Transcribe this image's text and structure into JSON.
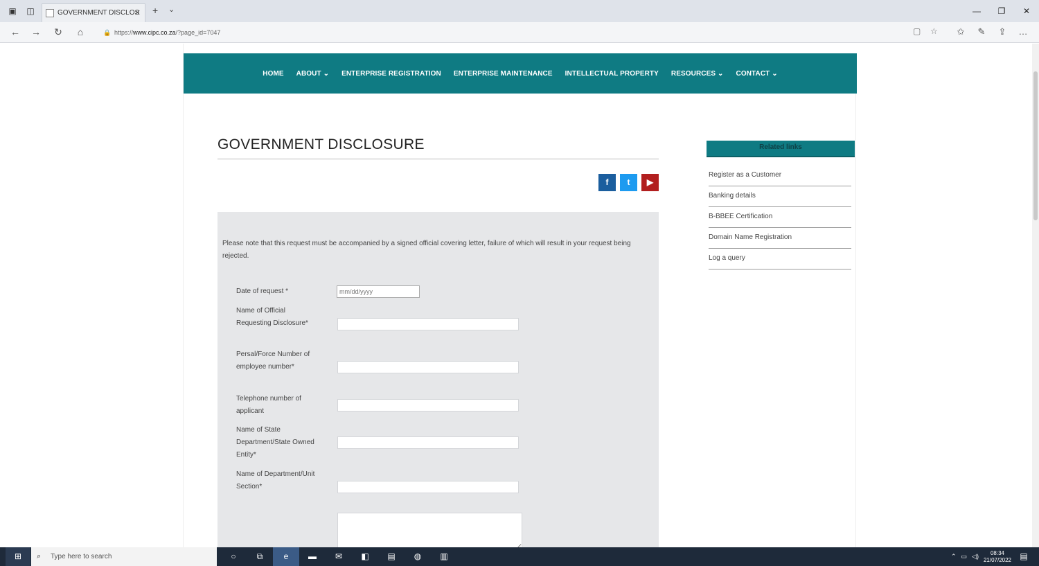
{
  "browser": {
    "tab_title": "GOVERNMENT DISCLOS",
    "url_prefix": "https://",
    "url_host": "www.cipc.co.za",
    "url_path": "/?page_id=7047",
    "icons": {
      "tab_set_aside": "tab-icon",
      "tab_preview": "tabs-icon",
      "new_tab": "+",
      "tab_dropdown": "⌄",
      "back": "←",
      "forward": "→",
      "refresh": "↻",
      "home": "⌂",
      "reading_view": "▢",
      "favorite": "☆",
      "favorites_bar": "✩",
      "notes": "✎",
      "share": "⇪",
      "more": "…",
      "minimize": "—",
      "maximize": "❐",
      "close": "✕"
    }
  },
  "nav": {
    "items": [
      {
        "label": "HOME"
      },
      {
        "label": "ABOUT ⌄"
      },
      {
        "label": "ENTERPRISE REGISTRATION"
      },
      {
        "label": "ENTERPRISE MAINTENANCE"
      },
      {
        "label": "INTELLECTUAL PROPERTY"
      },
      {
        "label": "RESOURCES ⌄"
      },
      {
        "label": "CONTACT ⌄"
      }
    ]
  },
  "page": {
    "title": "GOVERNMENT DISCLOSURE",
    "social": {
      "facebook": "f",
      "twitter": "t",
      "youtube": "▶"
    }
  },
  "form": {
    "notice": "Please note that this request must be accompanied by a signed official covering letter, failure of which will result in your request being rejected.",
    "date_label": "Date of request *",
    "date_placeholder": "mm/dd/yyyy",
    "official_name_label": "Name of Official Requesting Disclosure*",
    "persal_label": "Persal/Force Number of employee number*",
    "telephone_label": "Telephone number of applicant",
    "state_dept_label": "Name of State Department/State Owned Entity*",
    "unit_label": "Name of Department/Unit Section*"
  },
  "sidebar": {
    "header": "Related links",
    "links": [
      {
        "label": "Register as a Customer"
      },
      {
        "label": "Banking details"
      },
      {
        "label": "B-BBEE Certification"
      },
      {
        "label": "Domain Name Registration"
      },
      {
        "label": "Log a query"
      }
    ]
  },
  "taskbar": {
    "search_placeholder": "Type here to search",
    "time": "08:34",
    "date": "21/07/2022"
  },
  "colors": {
    "brand_teal": "#0f7b83",
    "form_bg": "#e6e7e9",
    "taskbar": "#1e2a3a"
  }
}
